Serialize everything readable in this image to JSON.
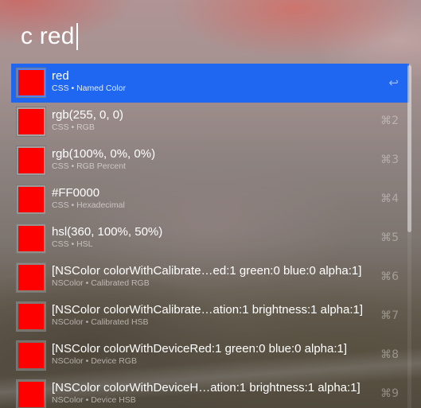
{
  "search": {
    "query": "c red"
  },
  "results": [
    {
      "title": "red",
      "subtitle": "CSS • Named Color",
      "shortcut": "↩",
      "color": "#FF0000",
      "selected": true
    },
    {
      "title": "rgb(255, 0, 0)",
      "subtitle": "CSS • RGB",
      "shortcut": "⌘2",
      "color": "#FF0000"
    },
    {
      "title": "rgb(100%, 0%, 0%)",
      "subtitle": "CSS • RGB Percent",
      "shortcut": "⌘3",
      "color": "#FF0000"
    },
    {
      "title": "#FF0000",
      "subtitle": "CSS • Hexadecimal",
      "shortcut": "⌘4",
      "color": "#FF0000"
    },
    {
      "title": "hsl(360, 100%, 50%)",
      "subtitle": "CSS • HSL",
      "shortcut": "⌘5",
      "color": "#FF0000"
    },
    {
      "title": "[NSColor colorWithCalibrate…ed:1 green:0 blue:0 alpha:1]",
      "subtitle": "NSColor • Calibrated RGB",
      "shortcut": "⌘6",
      "color": "#FF0000"
    },
    {
      "title": "[NSColor colorWithCalibrate…ation:1 brightness:1 alpha:1]",
      "subtitle": "NSColor • Calibrated HSB",
      "shortcut": "⌘7",
      "color": "#FF0000"
    },
    {
      "title": "[NSColor colorWithDeviceRed:1 green:0 blue:0 alpha:1]",
      "subtitle": "NSColor • Device RGB",
      "shortcut": "⌘8",
      "color": "#FF0000"
    },
    {
      "title": "[NSColor colorWithDeviceH…ation:1 brightness:1 alpha:1]",
      "subtitle": "NSColor • Device HSB",
      "shortcut": "⌘9",
      "color": "#FF0000"
    }
  ],
  "colors": {
    "selection": "#1F66F0",
    "swatch": "#FF0000"
  }
}
